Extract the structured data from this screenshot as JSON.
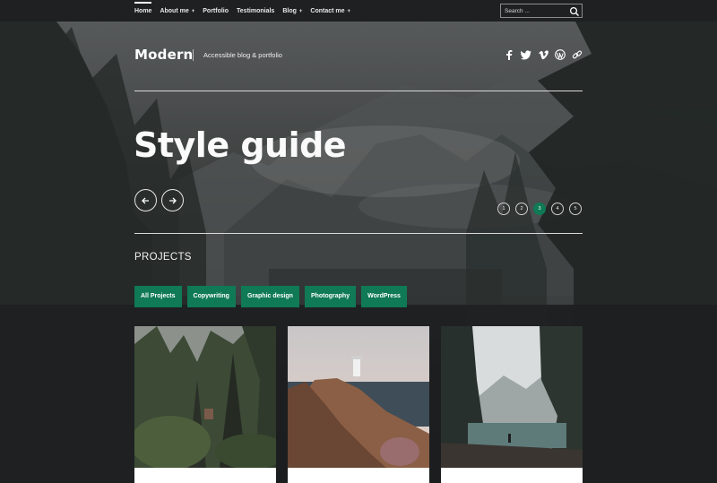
{
  "nav": {
    "items": [
      {
        "label": "Home",
        "active": true,
        "has_submenu": false
      },
      {
        "label": "About me",
        "active": false,
        "has_submenu": true
      },
      {
        "label": "Portfolio",
        "active": false,
        "has_submenu": false
      },
      {
        "label": "Testimonials",
        "active": false,
        "has_submenu": false
      },
      {
        "label": "Blog",
        "active": false,
        "has_submenu": true
      },
      {
        "label": "Contact me",
        "active": false,
        "has_submenu": true
      }
    ],
    "submenu_glyph": "+",
    "search_placeholder": "Search ..."
  },
  "header": {
    "site_title": "Modern",
    "tagline": "Accessible blog & portfolio",
    "social_icons": [
      "facebook-icon",
      "twitter-icon",
      "vimeo-icon",
      "wordpress-icon",
      "link-icon"
    ]
  },
  "hero": {
    "title": "Style guide",
    "prev_icon": "arrow-left-icon",
    "next_icon": "arrow-right-icon",
    "pages": [
      "1",
      "2",
      "3",
      "4",
      "5"
    ],
    "active_page": "3"
  },
  "projects": {
    "title": "PROJECTS",
    "filters": [
      "All Projects",
      "Copywriting",
      "Graphic design",
      "Photography",
      "WordPress"
    ]
  },
  "colors": {
    "accent": "#0f7a55",
    "nav_bg": "#1e2021",
    "text": "#ffffff"
  }
}
